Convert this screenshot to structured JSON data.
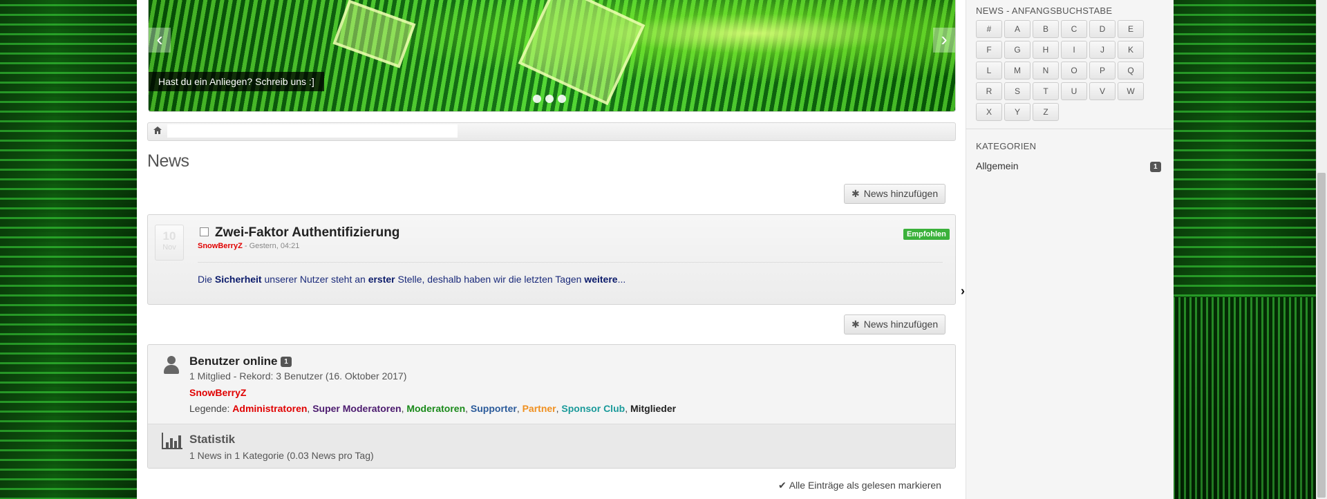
{
  "slider": {
    "caption": "Hast du ein Anliegen? Schreib uns :]",
    "prev_arrow": "‹",
    "next_arrow": "›"
  },
  "breadcrumb": {
    "home_icon": "home-icon"
  },
  "page": {
    "title": "News"
  },
  "actions": {
    "add_news_label": "News hinzufügen",
    "mark_all_read_label": "Alle Einträge als gelesen markieren"
  },
  "news": {
    "items": [
      {
        "day": "10",
        "month": "Nov",
        "title": "Zwei-Faktor Authentifizierung",
        "author": "SnowBerryZ",
        "time": " - Gestern, 04:21",
        "badge": "Empfohlen",
        "excerpt_parts": [
          "Die ",
          "Sicherheit",
          " unserer Nutzer steht an ",
          "erster",
          " Stelle, deshalb haben wir die letzten Tagen ",
          "weitere",
          "..."
        ]
      }
    ]
  },
  "online": {
    "title": "Benutzer online",
    "count": "1",
    "summary": "1 Mitglied - Rekord: 3 Benutzer (16. Oktober 2017)",
    "user": "SnowBerryZ",
    "legend_label": "Legende: ",
    "groups": [
      {
        "name": "Administratoren",
        "color": "#e00000"
      },
      {
        "name": "Super Moderatoren",
        "color": "#4b1a6e"
      },
      {
        "name": "Moderatoren",
        "color": "#1a8a1a"
      },
      {
        "name": "Supporter",
        "color": "#2a5a9a"
      },
      {
        "name": "Partner",
        "color": "#f09020"
      },
      {
        "name": "Sponsor Club",
        "color": "#1a9a9a"
      },
      {
        "name": "Mitglieder",
        "color": "#222222"
      }
    ]
  },
  "stats": {
    "title": "Statistik",
    "summary": "1 News in 1 Kategorie (0.03 News pro Tag)"
  },
  "sidebar": {
    "letters_heading": "NEWS - ANFANGSBUCHSTABE",
    "letters": [
      "#",
      "A",
      "B",
      "C",
      "D",
      "E",
      "F",
      "G",
      "H",
      "I",
      "J",
      "K",
      "L",
      "M",
      "N",
      "O",
      "P",
      "Q",
      "R",
      "S",
      "T",
      "U",
      "V",
      "W",
      "X",
      "Y",
      "Z"
    ],
    "categories_heading": "KATEGORIEN",
    "categories": [
      {
        "name": "Allgemein",
        "count": "1"
      }
    ]
  },
  "colors": {
    "accent_green": "#3bb13b",
    "author_red": "#e00000"
  }
}
